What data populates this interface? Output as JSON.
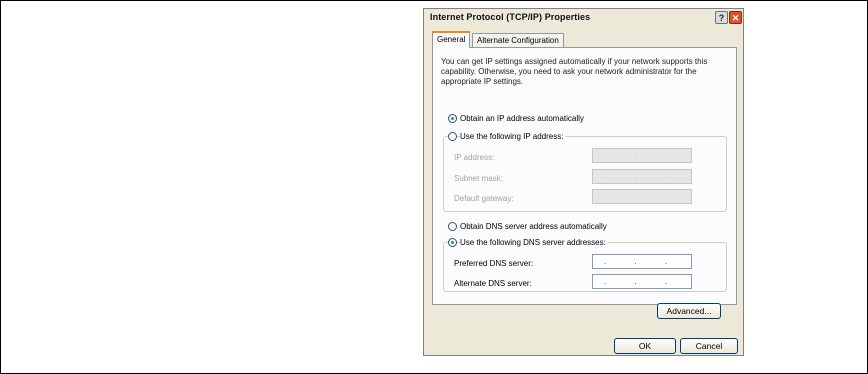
{
  "window": {
    "title": "Internet Protocol (TCP/IP) Properties",
    "help_glyph": "?",
    "close_glyph": "✕"
  },
  "tabs": [
    {
      "label": "General"
    },
    {
      "label": "Alternate Configuration"
    }
  ],
  "description": "You can get IP settings assigned automatically if your network supports this capability. Otherwise, you need to ask your network administrator for the appropriate IP settings.",
  "ip_mode": {
    "auto_label": "Obtain an IP address automatically",
    "manual_label": "Use the following IP address:",
    "selected": "auto"
  },
  "ip_fields": [
    {
      "label": "IP address:",
      "value": ". . ."
    },
    {
      "label": "Subnet mask:",
      "value": ". . ."
    },
    {
      "label": "Default gateway:",
      "value": ". . ."
    }
  ],
  "dns_mode": {
    "auto_label": "Obtain DNS server address automatically",
    "manual_label": "Use the following DNS server addresses:",
    "selected": "manual"
  },
  "dns_fields": [
    {
      "label": "Preferred DNS server:",
      "value": ". . ."
    },
    {
      "label": "Alternate DNS server:",
      "value": ". . ."
    }
  ],
  "buttons": {
    "advanced": "Advanced...",
    "ok": "OK",
    "cancel": "Cancel"
  }
}
